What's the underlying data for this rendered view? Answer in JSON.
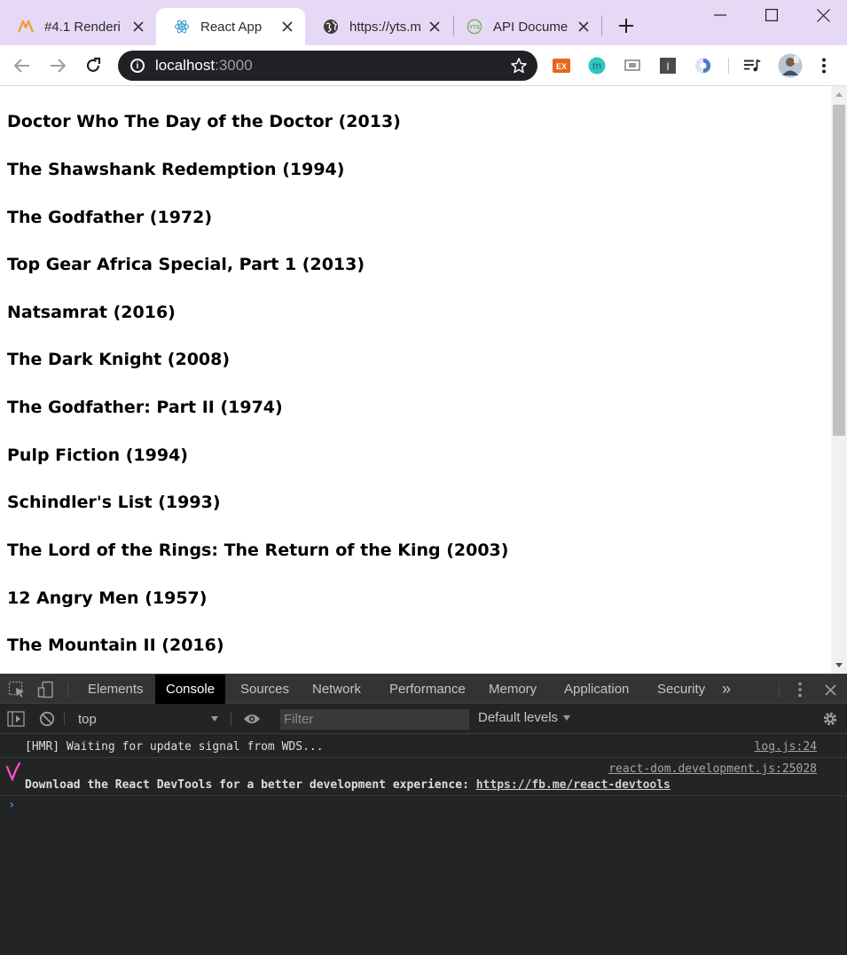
{
  "browser": {
    "tabs": [
      {
        "title": "#4.1 Renderi",
        "favicon": "wave-logo-icon",
        "active": false
      },
      {
        "title": "React App",
        "favicon": "react-logo-icon",
        "active": true
      },
      {
        "title": "https://yts.m",
        "favicon": "globe-icon",
        "active": false
      },
      {
        "title": "API Docume",
        "favicon": "yts-logo-icon",
        "active": false
      }
    ],
    "new_tab_icon": "plus-icon",
    "window_controls": [
      "minimize-icon",
      "maximize-icon",
      "close-icon"
    ]
  },
  "toolbar": {
    "url_host": "localhost",
    "url_port": ":3000",
    "extensions": [
      "ex-extension-icon",
      "m-extension-icon",
      "screen-extension-icon",
      "reader-extension-icon",
      "shield-extension-icon",
      "media-icon",
      "avatar",
      "menu-icon"
    ],
    "ex_label": "EX",
    "m_label": "m",
    "reader_label": "I"
  },
  "page": {
    "movies": [
      "Doctor Who The Day of the Doctor (2013)",
      "The Shawshank Redemption (1994)",
      "The Godfather (1972)",
      "Top Gear Africa Special, Part 1 (2013)",
      "Natsamrat (2016)",
      "The Dark Knight (2008)",
      "The Godfather: Part II (1974)",
      "Pulp Fiction (1994)",
      "Schindler's List (1993)",
      "The Lord of the Rings: The Return of the King (2003)",
      "12 Angry Men (1957)",
      "The Mountain II (2016)"
    ]
  },
  "devtools": {
    "tabs": [
      "Elements",
      "Console",
      "Sources",
      "Network",
      "Performance",
      "Memory",
      "Application",
      "Security"
    ],
    "active_tab": "Console",
    "more_tabs": "»",
    "context": "top",
    "filter_placeholder": "Filter",
    "levels": "Default levels",
    "messages": [
      {
        "text": "[HMR] Waiting for update signal from WDS...",
        "source": "log.js:24"
      },
      {
        "text": "Download the React DevTools for a better development experience: ",
        "link": "https://fb.me/react-devtools",
        "source": "react-dom.development.js:25028"
      }
    ],
    "prompt": "›",
    "colors": {
      "panel_bg": "#242424",
      "tab_bar_bg": "#333333",
      "prompt": "#3d8ef0"
    }
  },
  "colors": {
    "tab_strip": "#e7d9f5",
    "omnibox": "#202124",
    "annotation_mark": "#ff4fd0"
  }
}
